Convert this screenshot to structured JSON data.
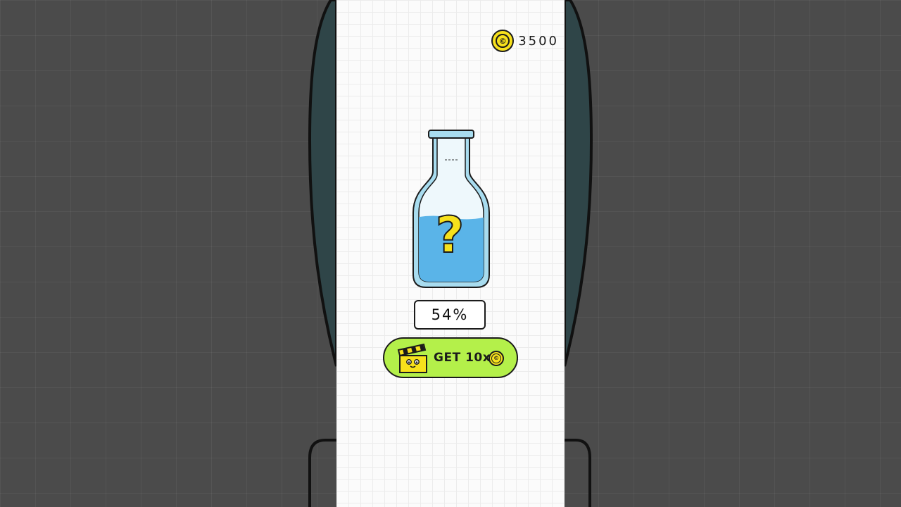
{
  "hud": {
    "coins": "3500",
    "coin_symbol": "©"
  },
  "bottle": {
    "hint_symbol": "?",
    "fill_level": 0.54,
    "water_color": "#5ab4e8",
    "glass_color": "#a8dcef"
  },
  "progress": {
    "percent_label": "54%"
  },
  "reward_button": {
    "label": "GET 10x",
    "coin_symbol": "©",
    "color": "#b4f04a"
  },
  "colors": {
    "coin": "#f7e11c",
    "outline": "#1b1b1b",
    "backdrop": "#4b4b4b",
    "backdrop_bottle": "#2f4548"
  }
}
